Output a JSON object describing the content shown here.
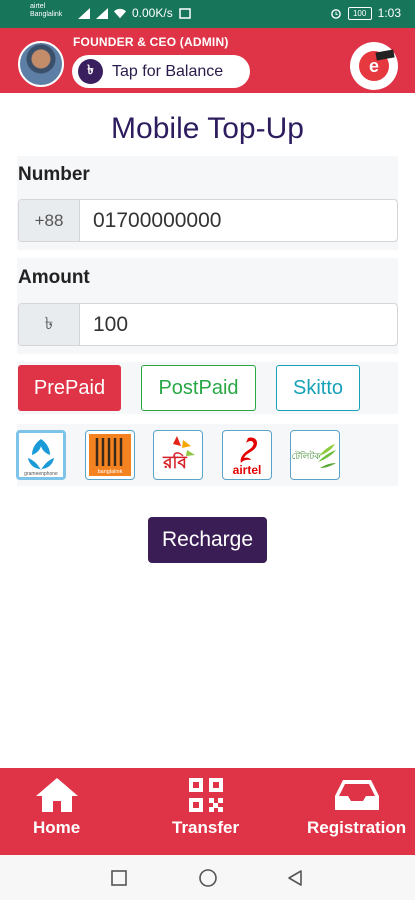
{
  "statusbar": {
    "carrier_line1": "airtel",
    "carrier_line2": "Banglalink",
    "speed": "0.00K/s",
    "battery": "100",
    "time": "1:03"
  },
  "header": {
    "role": "FOUNDER & CEO (ADMIN)",
    "balance_symbol": "৳",
    "balance_label": "Tap for Balance",
    "logo_letter": "e"
  },
  "page": {
    "title": "Mobile Top-Up"
  },
  "number": {
    "label": "Number",
    "prefix": "+88",
    "value": "01700000000"
  },
  "amount": {
    "label": "Amount",
    "prefix": "৳",
    "value": "100"
  },
  "types": [
    {
      "label": "PrePaid",
      "selected": true
    },
    {
      "label": "PostPaid",
      "selected": false
    },
    {
      "label": "Skitto",
      "selected": false
    }
  ],
  "operators": [
    {
      "name": "grameenphone",
      "selected": true
    },
    {
      "name": "banglalink",
      "selected": false
    },
    {
      "name": "robi",
      "selected": false
    },
    {
      "name": "airtel",
      "selected": false
    },
    {
      "name": "teletalk",
      "selected": false
    }
  ],
  "operator_texts": {
    "gp": "grameenphone",
    "bl": "banglalink",
    "robi": "রবি",
    "airtel": "airtel",
    "tt": "টেলিটক"
  },
  "actions": {
    "recharge": "Recharge"
  },
  "nav": [
    {
      "label": "Home",
      "icon": "home-icon"
    },
    {
      "label": "Transfer",
      "icon": "qr-code-icon"
    },
    {
      "label": "Registration",
      "icon": "inbox-icon"
    }
  ],
  "colors": {
    "primary": "#df3447",
    "dark": "#3b1d56",
    "status": "#17755a",
    "success": "#28a745",
    "info": "#17a2b8"
  }
}
